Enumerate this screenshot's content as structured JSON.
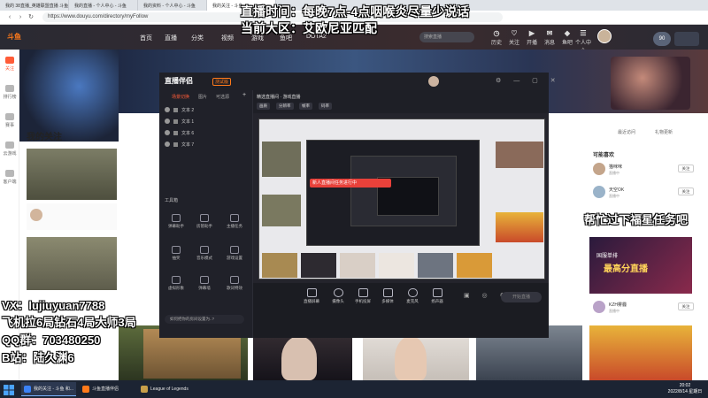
{
  "browser": {
    "tabs": [
      {
        "label": "我的 38直播_英雄联盟直播 斗鱼"
      },
      {
        "label": "我的直播 - 个人中心 - 斗鱼"
      },
      {
        "label": "我的资料 - 个人中心 - 斗鱼"
      },
      {
        "label": "我的关注 - 斗鱼"
      }
    ],
    "url": "https://www.douyu.com/directory/myFollow"
  },
  "site": {
    "logo": "斗鱼",
    "nav": [
      "首页",
      "直播",
      "分类",
      "视频",
      "游戏",
      "鱼吧",
      "DOTA2"
    ],
    "search_placeholder": "搜索直播",
    "header_icons": [
      {
        "label": "历史",
        "icon": "history-icon"
      },
      {
        "label": "关注",
        "icon": "follow-icon"
      },
      {
        "label": "开播",
        "icon": "live-icon"
      },
      {
        "label": "消息",
        "icon": "message-icon"
      },
      {
        "label": "鱼吧",
        "icon": "fishbar-icon"
      },
      {
        "label": "个人中心",
        "icon": "user-icon"
      }
    ],
    "level_badge": "90",
    "rail": [
      "关注",
      "排行榜",
      "赛事",
      "云游戏",
      "客户端"
    ]
  },
  "page": {
    "follow_title": "我的关注",
    "right_links": [
      "最近访问",
      "礼物更新"
    ],
    "recommend_title": "可能喜欢",
    "recommend": [
      {
        "name": "猫咪咪",
        "sub": "直播中",
        "btn": "关注"
      },
      {
        "name": "天空OK",
        "sub": "直播中",
        "btn": "关注"
      },
      {
        "name": "KZH雾霾",
        "sub": "直播中",
        "btn": "关注"
      }
    ],
    "ad_sub": "国服单排",
    "ad_title": "最高分直播"
  },
  "app": {
    "title": "直播伴侣",
    "version": "测试版",
    "tabs": [
      "场景切换",
      "图片",
      "可选源"
    ],
    "scenes": [
      "文本 2",
      "文本 1",
      "文本 6",
      "文本 7"
    ],
    "tools_title": "工具箱",
    "tools": [
      "弹幕助手",
      "房管助手",
      "主播任务",
      "抽奖",
      "音乐模式",
      "游戏设置",
      "虚拟形象",
      "弹幕墙",
      "歌词特效"
    ],
    "bottom_msg": "如何把你的房间设置为..?",
    "sub_title": "精选直播间 · 游戏直播",
    "sub_pills": [
      "画质",
      "分辨率",
      "帧率",
      "码率"
    ],
    "controls": [
      "直播屏幕",
      "摄像头",
      "手机投屏",
      "多媒体",
      "麦克风",
      "扬声器"
    ],
    "go_live": "开始直播",
    "red_banner": "新人直播间任务进行中"
  },
  "overlays": {
    "top1": "直播时间：每晚7点-4点咽喉炎尽量少说话",
    "top2": "当前大区：艾欧尼亚匹配",
    "mid_right": "帮忙过下福星任务吧",
    "vx": "VX：lujiuyuan7788",
    "rank": "飞机拉6局钻石4局大师3局",
    "qq": "QQ群：703480250",
    "bili": "B站：陆久渊6"
  },
  "taskbar": {
    "apps": [
      {
        "label": "我的关注 - 斗鱼 和..."
      },
      {
        "label": "斗鱼直播伴侣"
      },
      {
        "label": "League of Legends"
      }
    ],
    "time": "20:02",
    "date": "2022/8/14 星期日"
  },
  "colors": {
    "accent": "#ff5c38",
    "overlay_text": "#ffffff"
  }
}
